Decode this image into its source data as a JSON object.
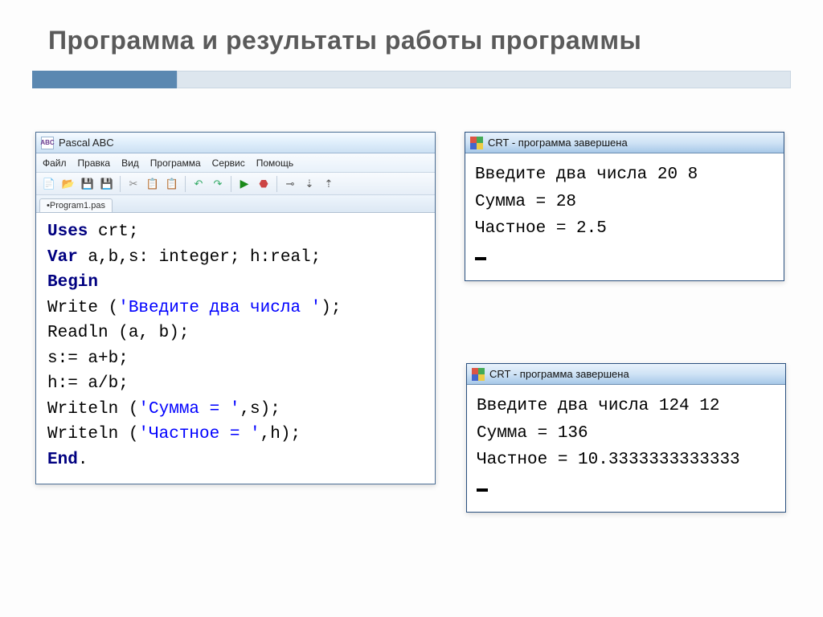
{
  "title": "Программа и результаты работы программы",
  "ide": {
    "app_icon_text": "ABC",
    "window_title": "Pascal ABC",
    "menu": [
      "Файл",
      "Правка",
      "Вид",
      "Программа",
      "Сервис",
      "Помощь"
    ],
    "tab": "•Program1.pas",
    "code": {
      "l1a": "Uses",
      "l1b": " crt;",
      "l2a": "Var",
      "l2b": " a,b,s: integer; h:real;",
      "l3": "Begin",
      "l4a": "Write (",
      "l4s": "'Введите два числа '",
      "l4b": ");",
      "l5": "Readln (a, b);",
      "l6": "s:= a+b;",
      "l7": "h:= a/b;",
      "l8a": "Writeln (",
      "l8s": "'Сумма = '",
      "l8b": ",s);",
      "l9a": "Writeln (",
      "l9s": "'Частное = '",
      "l9b": ",h);",
      "l10a": "End",
      "l10b": "."
    }
  },
  "crt1": {
    "title": "CRT - программа завершена",
    "line1": "Введите два числа 20 8",
    "line2": "Сумма = 28",
    "line3": "Частное = 2.5"
  },
  "crt2": {
    "title": "CRT - программа завершена",
    "line1": "Введите два числа 124 12",
    "line2": "Сумма = 136",
    "line3": "Частное = 10.3333333333333"
  }
}
